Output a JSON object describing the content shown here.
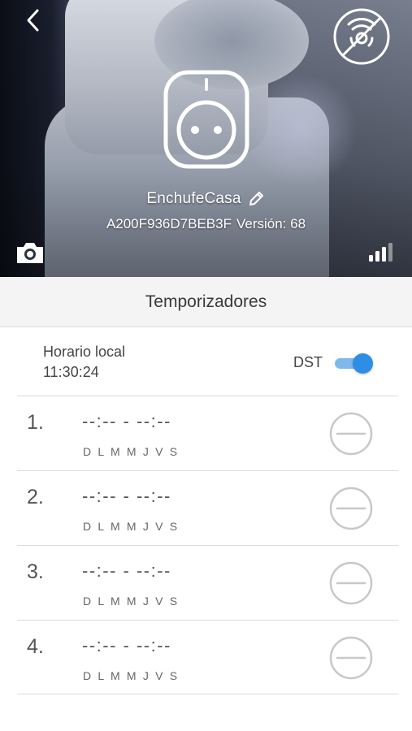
{
  "header": {
    "device_name": "EnchufeCasa",
    "device_id": "A200F936D7BEB3F",
    "version_text": "Versión: 68",
    "back_icon": "chevron-left-icon",
    "view_off_icon": "no-view-icon",
    "snapshot_icon": "camera-icon",
    "signal_icon": "signal-strength-icon",
    "device_icon": "smart-plug-icon",
    "edit_icon": "pencil-icon"
  },
  "section": {
    "title": "Temporizadores"
  },
  "local_time": {
    "label": "Horario local",
    "value": "11:30:24",
    "dst_label": "DST",
    "dst_enabled": true
  },
  "timers": [
    {
      "index": "1.",
      "range": "--:-- - --:--",
      "days": "D L M M J V S"
    },
    {
      "index": "2.",
      "range": "--:-- - --:--",
      "days": "D L M M J V S"
    },
    {
      "index": "3.",
      "range": "--:-- - --:--",
      "days": "D L M M J V S"
    },
    {
      "index": "4.",
      "range": "--:-- - --:--",
      "days": "D L M M J V S"
    }
  ],
  "colors": {
    "accent": "#2e8ee3",
    "accent_light": "#7fb9ec",
    "remove_circle": "#c8c8c8",
    "section_bg": "#f4f4f4"
  }
}
